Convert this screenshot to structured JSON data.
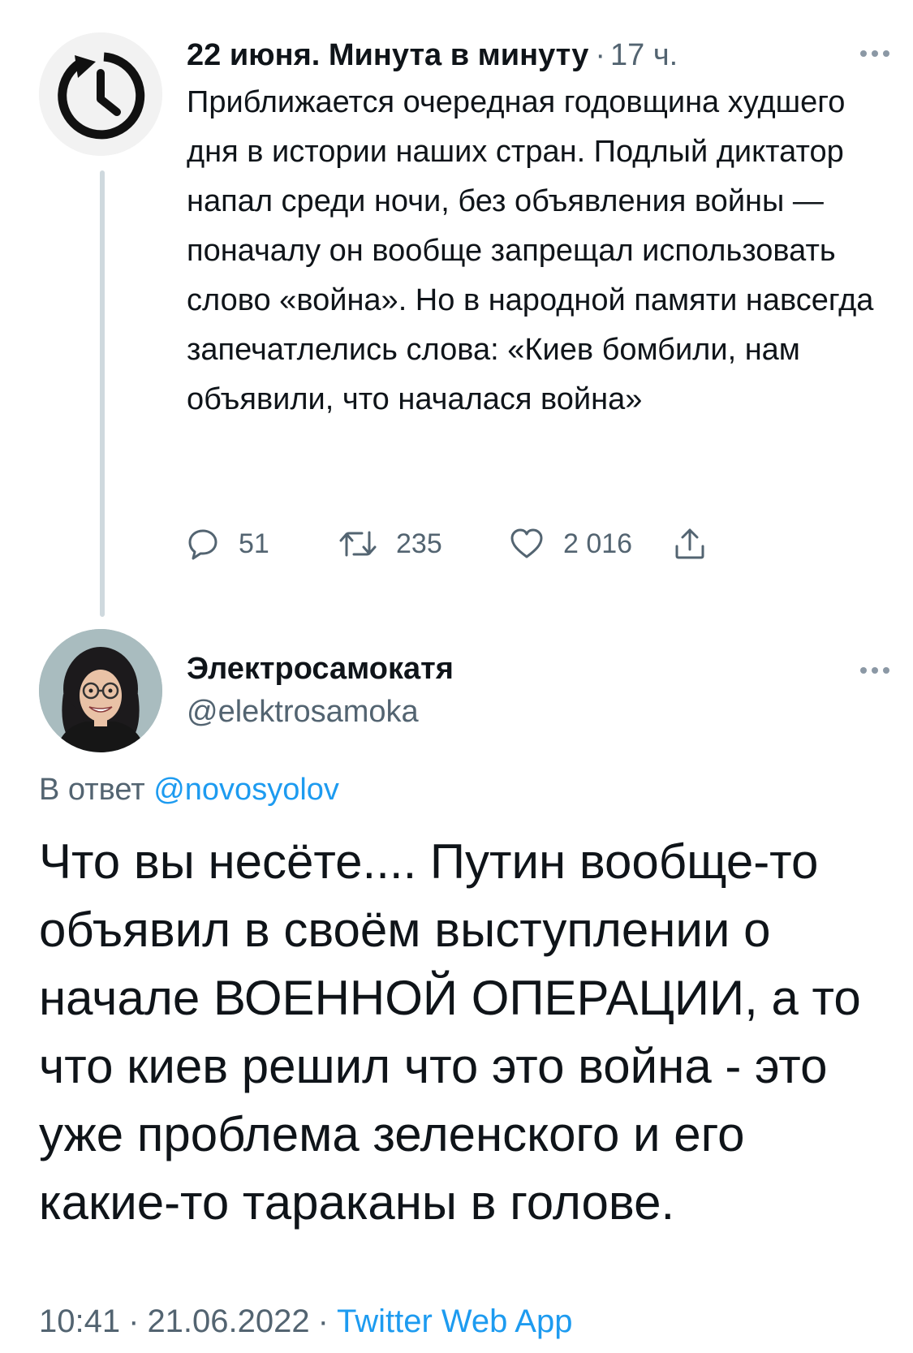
{
  "colors": {
    "primary_text": "#0f1419",
    "secondary_text": "#536471",
    "link": "#1d9bf0",
    "thread_line": "#cfd9de"
  },
  "tweet1": {
    "avatar_icon": "history-clock-icon",
    "author_name": "22 июня. Минута в минуту",
    "separator": "·",
    "time_ago": "17 ч.",
    "text": "Приближается очередная годовщина худшего дня в истории наших стран. Подлый диктатор напал среди ночи, без объявления войны — поначалу он вообще запрещал использовать слово «война». Но в народной памяти навсегда запечатлелись слова: «Киев бомбили, нам объявили, что началася война»",
    "actions": {
      "reply": {
        "icon": "reply-icon",
        "count": "51"
      },
      "retweet": {
        "icon": "retweet-icon",
        "count": "235"
      },
      "like": {
        "icon": "heart-icon",
        "count": "2 016"
      },
      "share": {
        "icon": "share-icon"
      }
    }
  },
  "tweet2": {
    "author_name": "Электросамокатя",
    "handle": "@elektrosamoka",
    "reply_prefix": "В ответ",
    "reply_mention": "@novosyolov",
    "text": "Что вы несёте.... Путин вообще-то объявил в своём выступлении о начале ВОЕННОЙ ОПЕРАЦИИ, а то что киев решил что это война - это уже проблема зеленского и его какие-то тараканы в голове.",
    "time": "10:41",
    "date": "21.06.2022",
    "separator": "·",
    "source": "Twitter Web App"
  }
}
